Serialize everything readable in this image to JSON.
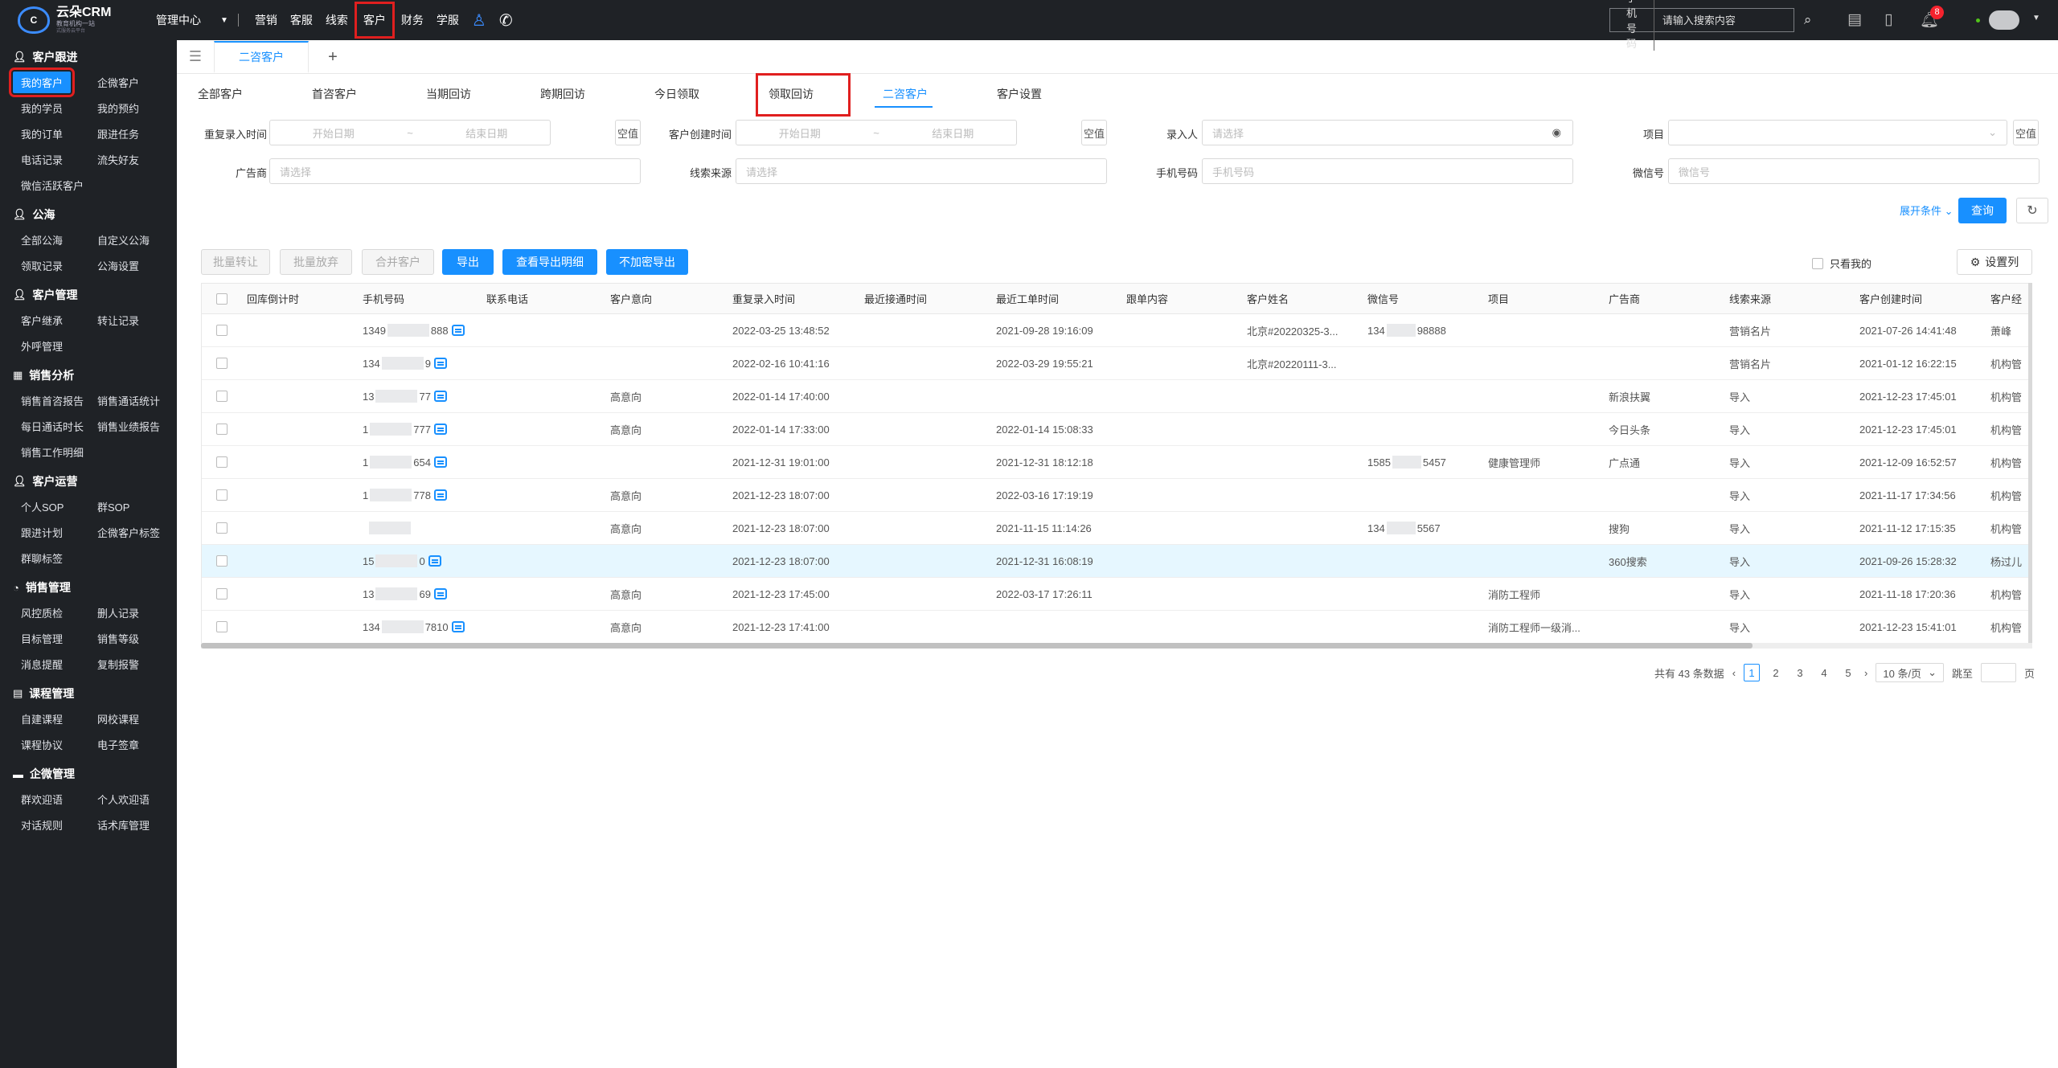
{
  "topbar": {
    "logo_main": "云朵CRM",
    "logo_sub": "教育机构一站",
    "logo_sub2": "式服务云平台",
    "mgmt_center": "管理中心",
    "nav": [
      "营销",
      "客服",
      "线索",
      "客户",
      "财务",
      "学服"
    ],
    "active_nav": "客户",
    "search_type": "手机号码",
    "search_placeholder": "请输入搜索内容",
    "notification_count": "8"
  },
  "sidebar": {
    "sections": [
      {
        "title": "客户跟进",
        "icon": "user-icon",
        "items": [
          "我的客户",
          "企微客户",
          "我的学员",
          "我的预约",
          "我的订单",
          "跟进任务",
          "电话记录",
          "流失好友",
          "微信活跃客户"
        ]
      },
      {
        "title": "公海",
        "icon": "user-icon",
        "items": [
          "全部公海",
          "自定义公海",
          "领取记录",
          "公海设置"
        ]
      },
      {
        "title": "客户管理",
        "icon": "user-icon",
        "items": [
          "客户继承",
          "转让记录",
          "外呼管理"
        ]
      },
      {
        "title": "销售分析",
        "icon": "list-icon",
        "items": [
          "销售首咨报告",
          "销售通话统计",
          "每日通话时长",
          "销售业绩报告",
          "销售工作明细"
        ]
      },
      {
        "title": "客户运营",
        "icon": "user-icon",
        "items": [
          "个人SOP",
          "群SOP",
          "跟进计划",
          "企微客户标签",
          "群聊标签"
        ]
      },
      {
        "title": "销售管理",
        "icon": "pie-icon",
        "items": [
          "风控质检",
          "删人记录",
          "目标管理",
          "销售等级",
          "消息提醒",
          "复制报警"
        ]
      },
      {
        "title": "课程管理",
        "icon": "book-icon",
        "items": [
          "自建课程",
          "网校课程",
          "课程协议",
          "电子签章"
        ]
      },
      {
        "title": "企微管理",
        "icon": "folder-icon",
        "items": [
          "群欢迎语",
          "个人欢迎语",
          "对话规则",
          "话术库管理"
        ]
      }
    ],
    "active_item": "我的客户"
  },
  "pagetab": {
    "label": "二咨客户"
  },
  "subtabs": [
    "全部客户",
    "首咨客户",
    "当期回访",
    "跨期回访",
    "今日领取",
    "领取回访",
    "二咨客户",
    "客户设置"
  ],
  "active_subtab": "二咨客户",
  "filters": {
    "repeat_entry_label": "重复录入时间",
    "create_time_label": "客户创建时间",
    "start_placeholder": "开始日期",
    "end_placeholder": "结束日期",
    "range_sep": "~",
    "clear_label": "空值",
    "entered_by_label": "录入人",
    "project_label": "项目",
    "advertiser_label": "广告商",
    "lead_source_label": "线索来源",
    "phone_label": "手机号码",
    "wechat_label": "微信号",
    "select_placeholder": "请选择",
    "phone_placeholder": "手机号码",
    "wechat_placeholder": "微信号"
  },
  "expand_label": "展开条件",
  "query_label": "查询",
  "actions": {
    "batch_transfer": "批量转让",
    "batch_abandon": "批量放弃",
    "merge": "合并客户",
    "export": "导出",
    "view_export_detail": "查看导出明细",
    "export_unencrypted": "不加密导出",
    "only_mine": "只看我的",
    "set_columns": "设置列"
  },
  "table": {
    "headers": [
      "回库倒计时",
      "手机号码",
      "联系电话",
      "客户意向",
      "重复录入时间",
      "最近接通时间",
      "最近工单时间",
      "跟单内容",
      "客户姓名",
      "微信号",
      "项目",
      "广告商",
      "线索来源",
      "客户创建时间",
      "客户经"
    ],
    "rows": [
      {
        "phone_a": "1349",
        "phone_b": "888",
        "intent": "",
        "repeat": "2022-03-25 13:48:52",
        "recent_call": "",
        "ticket": "2021-09-28 19:16:09",
        "name": "北京#20220325-3...",
        "wx_a": "134",
        "wx_b": "98888",
        "project": "",
        "advertiser": "",
        "source": "营销名片",
        "created": "2021-07-26 14:41:48",
        "owner": "萧峰"
      },
      {
        "phone_a": "134",
        "phone_b": "9",
        "intent": "",
        "repeat": "2022-02-16 10:41:16",
        "recent_call": "",
        "ticket": "2022-03-29 19:55:21",
        "name": "北京#20220111-3...",
        "wx_a": "",
        "wx_b": "",
        "project": "",
        "advertiser": "",
        "source": "营销名片",
        "created": "2021-01-12 16:22:15",
        "owner": "机构管"
      },
      {
        "phone_a": "13",
        "phone_b": "77",
        "intent": "高意向",
        "repeat": "2022-01-14 17:40:00",
        "recent_call": "",
        "ticket": "",
        "name": "",
        "wx_a": "",
        "wx_b": "",
        "project": "",
        "advertiser": "新浪扶翼",
        "source": "导入",
        "created": "2021-12-23 17:45:01",
        "owner": "机构管"
      },
      {
        "phone_a": "1",
        "phone_b": "777",
        "intent": "高意向",
        "repeat": "2022-01-14 17:33:00",
        "recent_call": "",
        "ticket": "2022-01-14 15:08:33",
        "name": "",
        "wx_a": "",
        "wx_b": "",
        "project": "",
        "advertiser": "今日头条",
        "source": "导入",
        "created": "2021-12-23 17:45:01",
        "owner": "机构管"
      },
      {
        "phone_a": "1",
        "phone_b": "654",
        "intent": "",
        "repeat": "2021-12-31 19:01:00",
        "recent_call": "",
        "ticket": "2021-12-31 18:12:18",
        "name": "",
        "wx_a": "1585",
        "wx_b": "5457",
        "project": "健康管理师",
        "advertiser": "广点通",
        "source": "导入",
        "created": "2021-12-09 16:52:57",
        "owner": "机构管"
      },
      {
        "phone_a": "1",
        "phone_b": "778",
        "intent": "高意向",
        "repeat": "2021-12-23 18:07:00",
        "recent_call": "",
        "ticket": "2022-03-16 17:19:19",
        "name": "",
        "wx_a": "",
        "wx_b": "",
        "project": "",
        "advertiser": "",
        "source": "导入",
        "created": "2021-11-17 17:34:56",
        "owner": "机构管"
      },
      {
        "phone_a": "",
        "phone_b": "",
        "intent": "高意向",
        "repeat": "2021-12-23 18:07:00",
        "recent_call": "",
        "ticket": "2021-11-15 11:14:26",
        "name": "",
        "wx_a": "134",
        "wx_b": "5567",
        "project": "",
        "advertiser": "搜狗",
        "source": "导入",
        "created": "2021-11-12 17:15:35",
        "owner": "机构管"
      },
      {
        "phone_a": "15",
        "phone_b": "0",
        "intent": "",
        "repeat": "2021-12-23 18:07:00",
        "recent_call": "",
        "ticket": "2021-12-31 16:08:19",
        "name": "",
        "wx_a": "",
        "wx_b": "",
        "project": "",
        "advertiser": "360搜索",
        "source": "导入",
        "created": "2021-09-26 15:28:32",
        "owner": "杨过儿"
      },
      {
        "phone_a": "13",
        "phone_b": "69",
        "intent": "高意向",
        "repeat": "2021-12-23 17:45:00",
        "recent_call": "",
        "ticket": "2022-03-17 17:26:11",
        "name": "",
        "wx_a": "",
        "wx_b": "",
        "project": "消防工程师",
        "advertiser": "",
        "source": "导入",
        "created": "2021-11-18 17:20:36",
        "owner": "机构管"
      },
      {
        "phone_a": "134",
        "phone_b": "7810",
        "intent": "高意向",
        "repeat": "2021-12-23 17:41:00",
        "recent_call": "",
        "ticket": "",
        "name": "",
        "wx_a": "",
        "wx_b": "",
        "project": "消防工程师一级消...",
        "advertiser": "",
        "source": "导入",
        "created": "2021-12-23 15:41:01",
        "owner": "机构管"
      }
    ],
    "highlighted_row": 7
  },
  "pager": {
    "total": "共有 43 条数据",
    "pages": [
      "1",
      "2",
      "3",
      "4",
      "5"
    ],
    "current": "1",
    "page_size": "10 条/页",
    "jump_label": "跳至",
    "page_unit": "页"
  }
}
